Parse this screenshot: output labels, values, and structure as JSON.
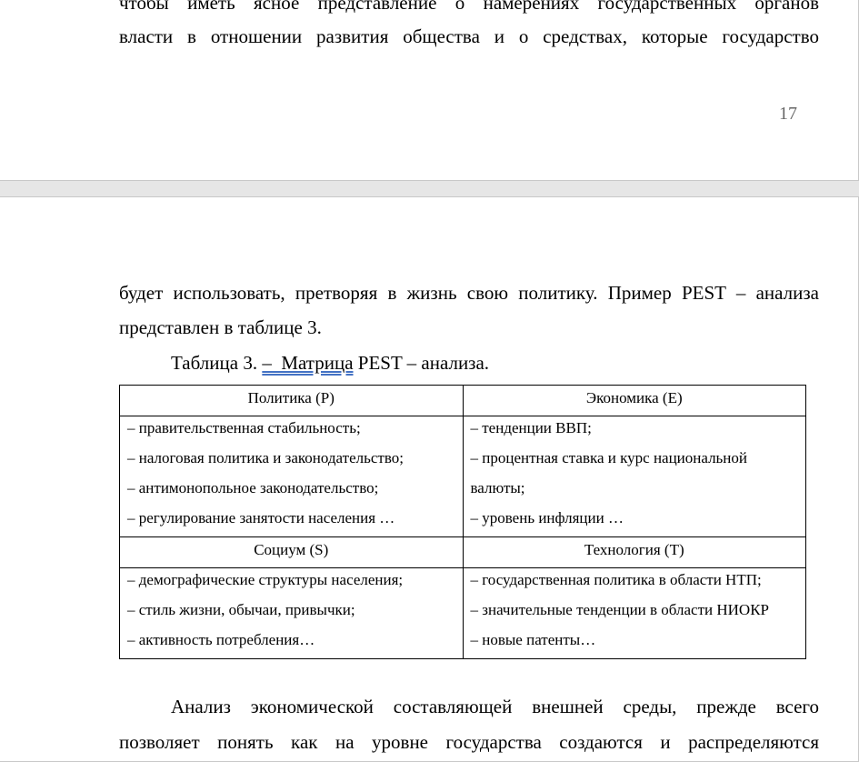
{
  "page1": {
    "lines": [
      "чтобы иметь ясное представление о намерениях государственных органов",
      "власти в отношении развития общества и о средствах, которые государство"
    ],
    "page_number": "17"
  },
  "page2": {
    "lines": [
      "будет использовать, претворяя в жизнь свою политику. Пример PEST – анализа",
      "представлен в таблице 3."
    ],
    "caption": {
      "prefix": "Таблица 3. ",
      "underlined": "–  Матрица",
      "suffix": " PEST – анализа."
    },
    "table": {
      "headers": [
        "Политика (P)",
        "Экономика (E)",
        "Социум (S)",
        "Технология (T)"
      ],
      "cells": [
        [
          "– правительственная стабильность;",
          "– налоговая политика и законодательство;",
          "– антимонопольное законодательство;",
          "–  регулирование занятости населения …"
        ],
        [
          "– тенденции ВВП;",
          "– процентная ставка и курс национальной",
          "валюты;",
          "– уровень инфляции …"
        ],
        [
          "– демографические структуры населения;",
          "– стиль жизни, обычаи, привычки;",
          "– активность потребления…"
        ],
        [
          "– государственная политика в области НТП;",
          "– значительные тенденции в области НИОКР",
          "– новые патенты…"
        ]
      ]
    },
    "after": [
      "Анализ экономической составляющей внешней среды, прежде всего",
      "позволяет понять как на уровне государства создаются и распределяются"
    ]
  }
}
